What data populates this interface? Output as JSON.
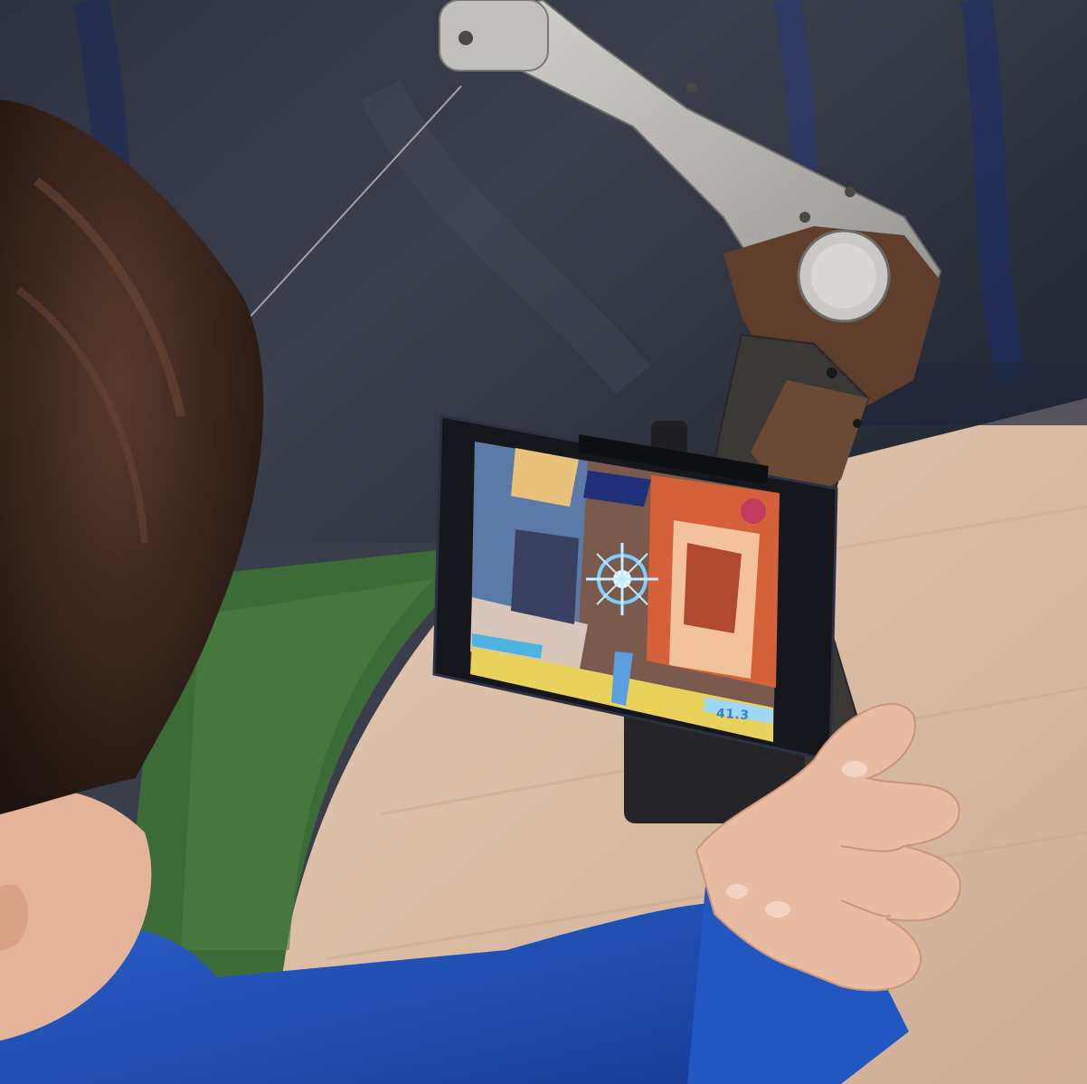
{
  "scene": {
    "description_hidden": "",
    "colors": {
      "backdrop": "#343845",
      "backdrop_blue": "#22305f",
      "floor": "#d9bca5",
      "grass": "#3f6e3a",
      "bow_silver": "#b9b7b3",
      "bow_dark": "#3d3a38",
      "bow_brown": "#6b4a35",
      "hair": "#2b1d17",
      "skin": "#e6b8a0",
      "shirt": "#1f4fb8",
      "phone_body": "#15171d"
    }
  },
  "phone": {
    "side_label": "",
    "game": {
      "score_text": "41.3"
    }
  },
  "icons": [
    "phone-icon",
    "bow-icon",
    "crosshair-icon",
    "hand-icon"
  ]
}
